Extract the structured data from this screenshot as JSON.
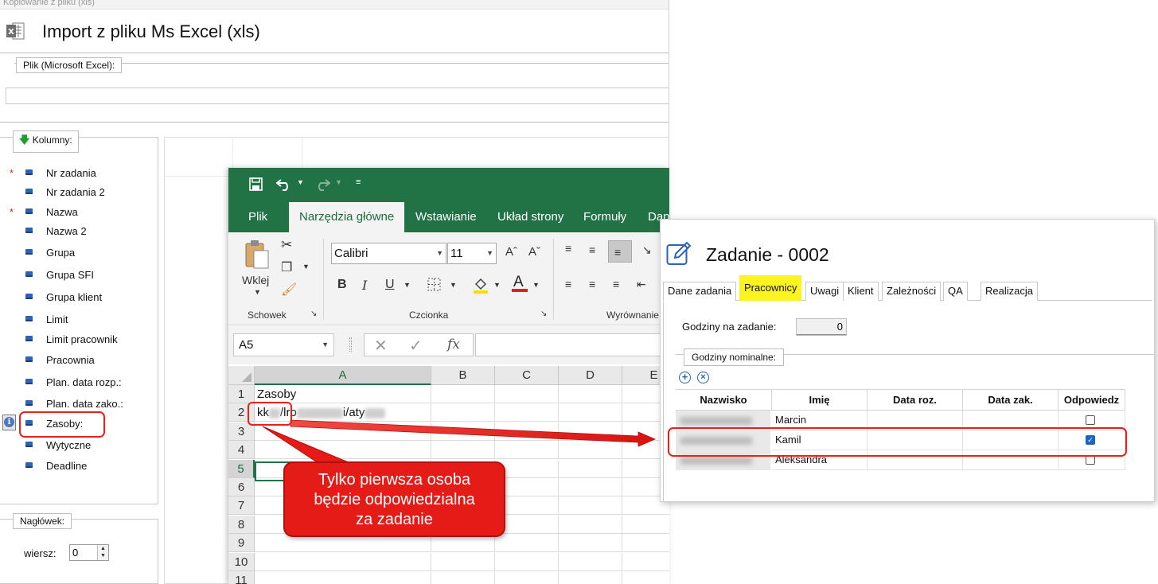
{
  "import_dialog": {
    "top_strip_text": "Kopiowanie z pliku (xls)",
    "title": "Import z pliku Ms Excel (xls)",
    "file_group_label": "Plik (Microsoft Excel):",
    "file_value": "",
    "columns_group_label": "Kolumny:",
    "columns": [
      {
        "label": "Nr zadania",
        "required": true
      },
      {
        "label": "Nr zadania 2",
        "required": false
      },
      {
        "label": "Nazwa",
        "required": true
      },
      {
        "label": "Nazwa 2",
        "required": false
      },
      {
        "label": "Grupa",
        "required": false
      },
      {
        "label": "Grupa SFI",
        "required": false
      },
      {
        "label": "Grupa klient",
        "required": false
      },
      {
        "label": "Limit",
        "required": false
      },
      {
        "label": "Limit pracownik",
        "required": false
      },
      {
        "label": "Pracownia",
        "required": false
      },
      {
        "label": "Plan. data rozp.:",
        "required": false
      },
      {
        "label": "Plan. data zako.:",
        "required": false
      },
      {
        "label": "Zasoby:",
        "required": false
      },
      {
        "label": "Wytyczne",
        "required": false
      },
      {
        "label": "Deadline",
        "required": false
      }
    ],
    "required_mark": "*",
    "header_group_label": "Nagłówek:",
    "row_label": "wiersz:",
    "row_value": "0"
  },
  "excel": {
    "tabs": [
      "Plik",
      "Narzędzia główne",
      "Wstawianie",
      "Układ strony",
      "Formuły",
      "Dan"
    ],
    "active_tab": "Narzędzia główne",
    "clipboard": {
      "paste_label": "Wklej",
      "group_label": "Schowek"
    },
    "font": {
      "name": "Calibri",
      "size": "11",
      "group_label": "Czcionka",
      "bold": "B",
      "italic": "I",
      "underline": "U"
    },
    "alignment_group_label": "Wyrównanie",
    "name_box": "A5",
    "fx_label": "fx",
    "columns": [
      "A",
      "B",
      "C",
      "D",
      "E"
    ],
    "rows": [
      "1",
      "2",
      "3",
      "4",
      "5",
      "6",
      "7",
      "8",
      "9",
      "10",
      "11"
    ],
    "cells": {
      "a1": "Zasoby",
      "a2_parts": [
        "kk",
        "/lro",
        "i/aty"
      ]
    }
  },
  "task": {
    "title": "Zadanie - 0002",
    "tabs": [
      "Dane zadania",
      "Pracownicy",
      "Uwagi",
      "Klient",
      "Zależności",
      "QA",
      "Realizacja"
    ],
    "active_tab": "Pracownicy",
    "hours_label": "Godziny na zadanie:",
    "hours_value": "0",
    "nominal_group_label": "Godziny nominalne:",
    "grid": {
      "headers": [
        "Nazwisko",
        "Imię",
        "Data roz.",
        "Data zak.",
        "Odpowiedz"
      ],
      "rows": [
        {
          "first_name": "Marcin",
          "responsible": false
        },
        {
          "first_name": "Kamil",
          "responsible": true
        },
        {
          "first_name": "Aleksandra",
          "responsible": false
        }
      ]
    }
  },
  "annotation": {
    "callout_lines": [
      "Tylko pierwsza osoba",
      "będzie odpowiedzialna",
      "za zadanie"
    ],
    "color": "#e41b17"
  },
  "colors": {
    "excel_green": "#217346",
    "highlight_yellow": "#fbf41e",
    "annotation_red": "#e8211d",
    "bullet_blue": "#2e62b3"
  }
}
